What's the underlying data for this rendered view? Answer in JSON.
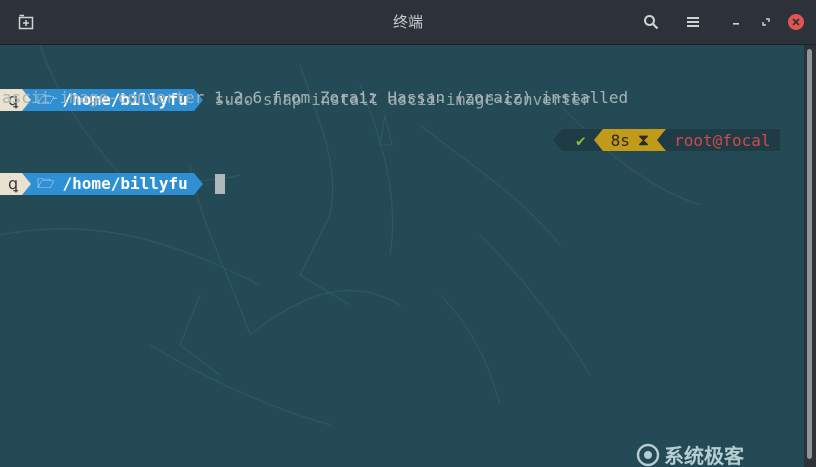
{
  "window": {
    "title": "终端"
  },
  "titlebar_icons": [
    "new-tab-icon",
    "search-icon",
    "menu-icon",
    "minimize-icon",
    "maximize-icon",
    "close-icon"
  ],
  "terminal": {
    "lines": [
      {
        "os_glyph": "ꝗ",
        "folder_glyph": "🗁",
        "path": "/home/billyfu",
        "command": "sudo snap install ascii-image-converter"
      },
      {
        "output": "ascii-image-converter 1.2.6 from Zoraiz Hassan (zoraiz) installed"
      },
      {
        "os_glyph": "ꝗ",
        "folder_glyph": "🗁",
        "path": "/home/billyfu",
        "command": ""
      }
    ],
    "right_prompt": {
      "status": "✔",
      "duration": "8s",
      "hourglass": "⧗",
      "user_host": "root@focal"
    }
  },
  "watermark": {
    "text": "系统极客"
  },
  "colors": {
    "background": "#234a55",
    "os_segment": "#e8e2cf",
    "dir_segment": "#2f8fd3",
    "time_segment": "#c29a1a",
    "status_ok": "#7fbf3f",
    "user_host": "#d04a4a",
    "close_button": "#e0554f"
  }
}
